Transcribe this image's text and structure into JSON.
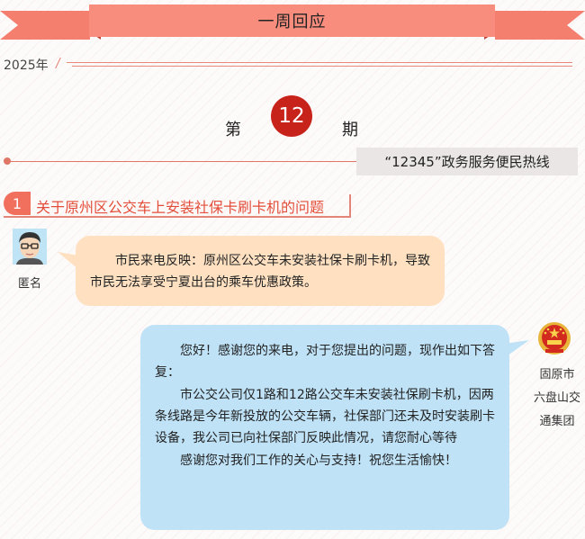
{
  "header": {
    "title": "一周回应"
  },
  "year": "2025年",
  "issue": {
    "prefix": "第",
    "number": "12",
    "suffix": "期"
  },
  "hotline": "“12345”政务服务便民热线",
  "topic": {
    "number": "1",
    "title": "关于原州区公交车上安装社保卡刷卡机的问题"
  },
  "citizen": {
    "name": "匿名",
    "message": "市民来电反映：原州区公交车未安装社保卡刷卡机，导致市民无法享受宁夏出台的乘车优惠政策。"
  },
  "reply": {
    "org_lines": [
      "固原市",
      "六盘山交",
      "通集团"
    ],
    "paragraphs": [
      "您好！感谢您的来电，对于您提出的问题，现作出如下答复：",
      "市公交公司仅1路和12路公交车未安装社保刷卡机，因两条线路是今年新投放的公交车辆，社保部门还未及时安装刷卡设备，我公司已向社保部门反映此情况，请您耐心等待",
      "感谢您对我们工作的关心与支持！祝您生活愉快！"
    ]
  },
  "colors": {
    "accent": "#f88d7e",
    "issue_circle": "#c8231b",
    "citizen_bubble": "#ffe1c2",
    "reply_bubble": "#bfe2f7"
  }
}
